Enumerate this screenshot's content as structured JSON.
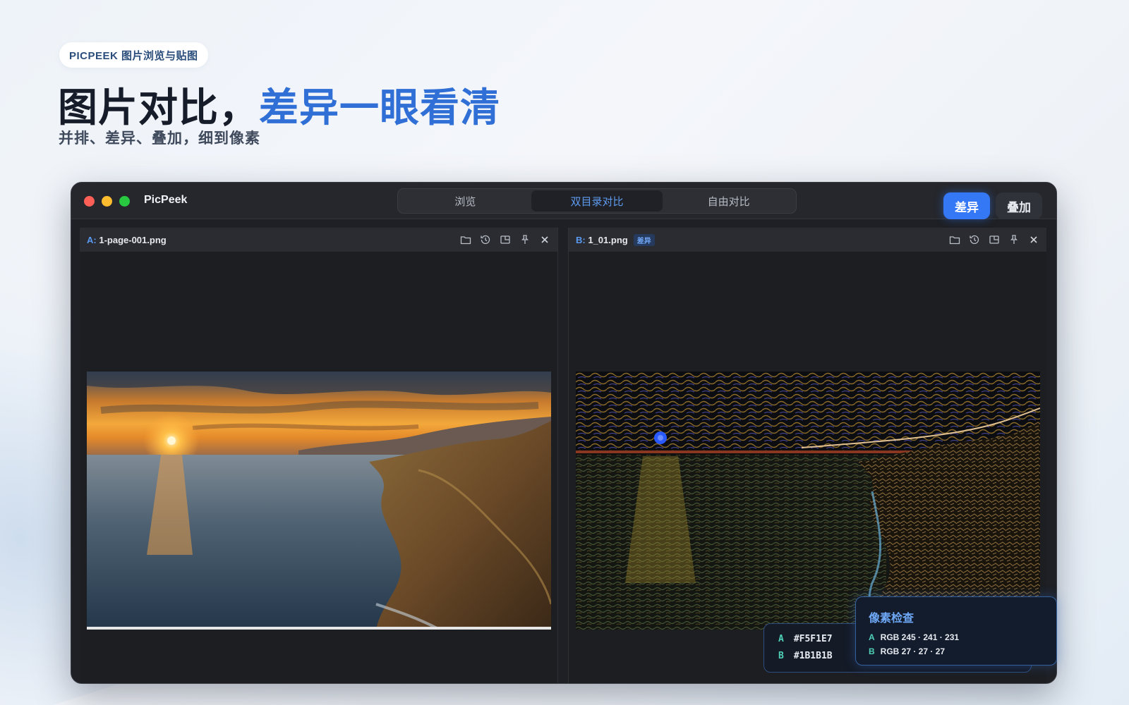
{
  "badge": "PICPEEK 图片浏览与贴图",
  "headline": {
    "main": "图片对比，",
    "accent": "差异一眼看清"
  },
  "subhead": "并排、差异、叠加，细到像素",
  "window": {
    "app_name": "PicPeek",
    "tabs": [
      {
        "label": "浏览",
        "active": false
      },
      {
        "label": "双目录对比",
        "active": true
      },
      {
        "label": "自由对比",
        "active": false
      }
    ],
    "mode_buttons": {
      "diff": "差异",
      "overlay": "叠加"
    },
    "pane_a": {
      "prefix": "A:",
      "filename": "1-page-001.png"
    },
    "pane_b": {
      "prefix": "B:",
      "filename": "1_01.png",
      "tag": "差异"
    },
    "pane_icons": [
      "folder-icon",
      "history-icon",
      "fit-window-icon",
      "pin-icon",
      "close-icon"
    ]
  },
  "pixel_hex": {
    "a_label": "A",
    "a_value": "#F5F1E7",
    "b_label": "B",
    "b_value": "#1B1B1B"
  },
  "pixel_inspector": {
    "title": "像素检查",
    "a_label": "A",
    "a_value": "RGB 245 · 241 · 231",
    "b_label": "B",
    "b_value": "RGB 27 · 27 · 27"
  },
  "colors": {
    "accent": "#3478f6",
    "window_bg": "#1e2025",
    "headline_accent": "#2f6fd6"
  }
}
